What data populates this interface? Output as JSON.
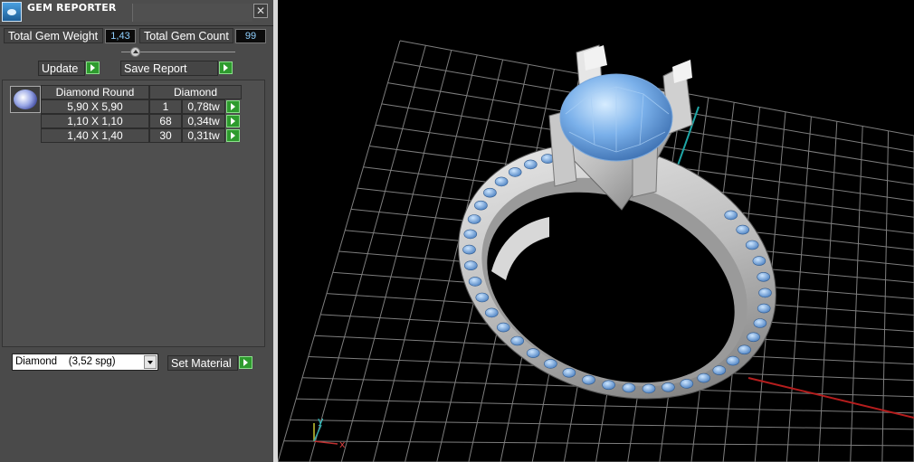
{
  "window": {
    "title": "GEM REPORTER"
  },
  "stats": {
    "weight_label": "Total Gem Weight",
    "weight_value": "1,43",
    "count_label": "Total Gem Count",
    "count_value": "99"
  },
  "toolbar": {
    "update_label": "Update",
    "save_label": "Save Report"
  },
  "gem_table": {
    "headers": [
      "Diamond Round",
      "Diamond"
    ],
    "rows": [
      {
        "size": "5,90 X 5,90",
        "count": "1",
        "weight": "0,78tw"
      },
      {
        "size": "1,10 X 1,10",
        "count": "68",
        "weight": "0,34tw"
      },
      {
        "size": "1,40 X 1,40",
        "count": "30",
        "weight": "0,31tw"
      }
    ]
  },
  "material": {
    "selected": "Diamond    (3,52 spg)",
    "set_label": "Set Material"
  },
  "viewport": {
    "axis_y": "y",
    "axis_x": "x",
    "colors": {
      "gem": "#7aaee8",
      "metal": "#c8c8c8",
      "grid": "#9a9a9a",
      "x_axis": "#c22020",
      "y_axis": "#20a0a0"
    }
  }
}
